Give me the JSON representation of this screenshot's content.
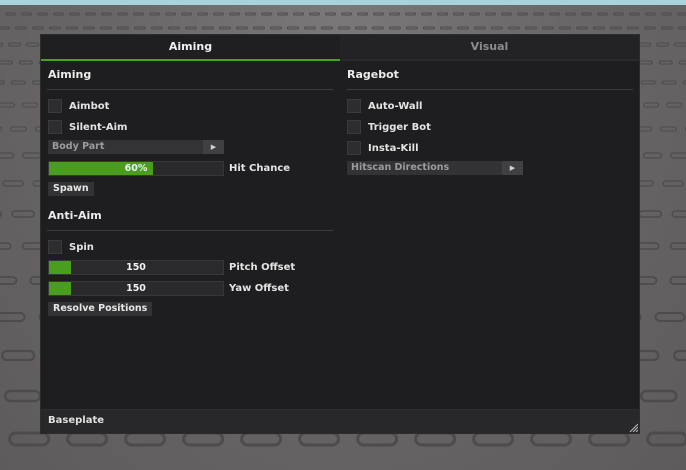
{
  "tabs": [
    {
      "label": "Aiming",
      "active": true
    },
    {
      "label": "Visual",
      "active": false
    }
  ],
  "left": {
    "aiming": {
      "title": "Aiming",
      "checks": [
        {
          "label": "Aimbot",
          "checked": false
        },
        {
          "label": "Silent-Aim",
          "checked": false
        }
      ],
      "body_part": {
        "value": "Body Part"
      },
      "hit_chance": {
        "value": "60%",
        "fraction": 0.6,
        "label": "Hit Chance"
      },
      "spawn_label": "Spawn"
    },
    "antiaim": {
      "title": "Anti-Aim",
      "spin": {
        "label": "Spin",
        "checked": false
      },
      "pitch": {
        "value": "150",
        "fraction": 0.125,
        "label": "Pitch Offset"
      },
      "yaw": {
        "value": "150",
        "fraction": 0.125,
        "label": "Yaw Offset"
      },
      "resolve_label": "Resolve Positions"
    }
  },
  "right": {
    "ragebot": {
      "title": "Ragebot",
      "checks": [
        {
          "label": "Auto-Wall",
          "checked": false
        },
        {
          "label": "Trigger Bot",
          "checked": false
        },
        {
          "label": "Insta-Kill",
          "checked": false
        }
      ],
      "hitscan": {
        "value": "Hitscan Directions"
      }
    }
  },
  "footer": {
    "label": "Baseplate"
  },
  "colors": {
    "accent": "#4a9e1d",
    "panel": "#1e1e20",
    "background": "#6b6869"
  },
  "icons": {
    "dropdown_arrow": "play-arrow-icon",
    "resize": "resize-grip-icon"
  }
}
